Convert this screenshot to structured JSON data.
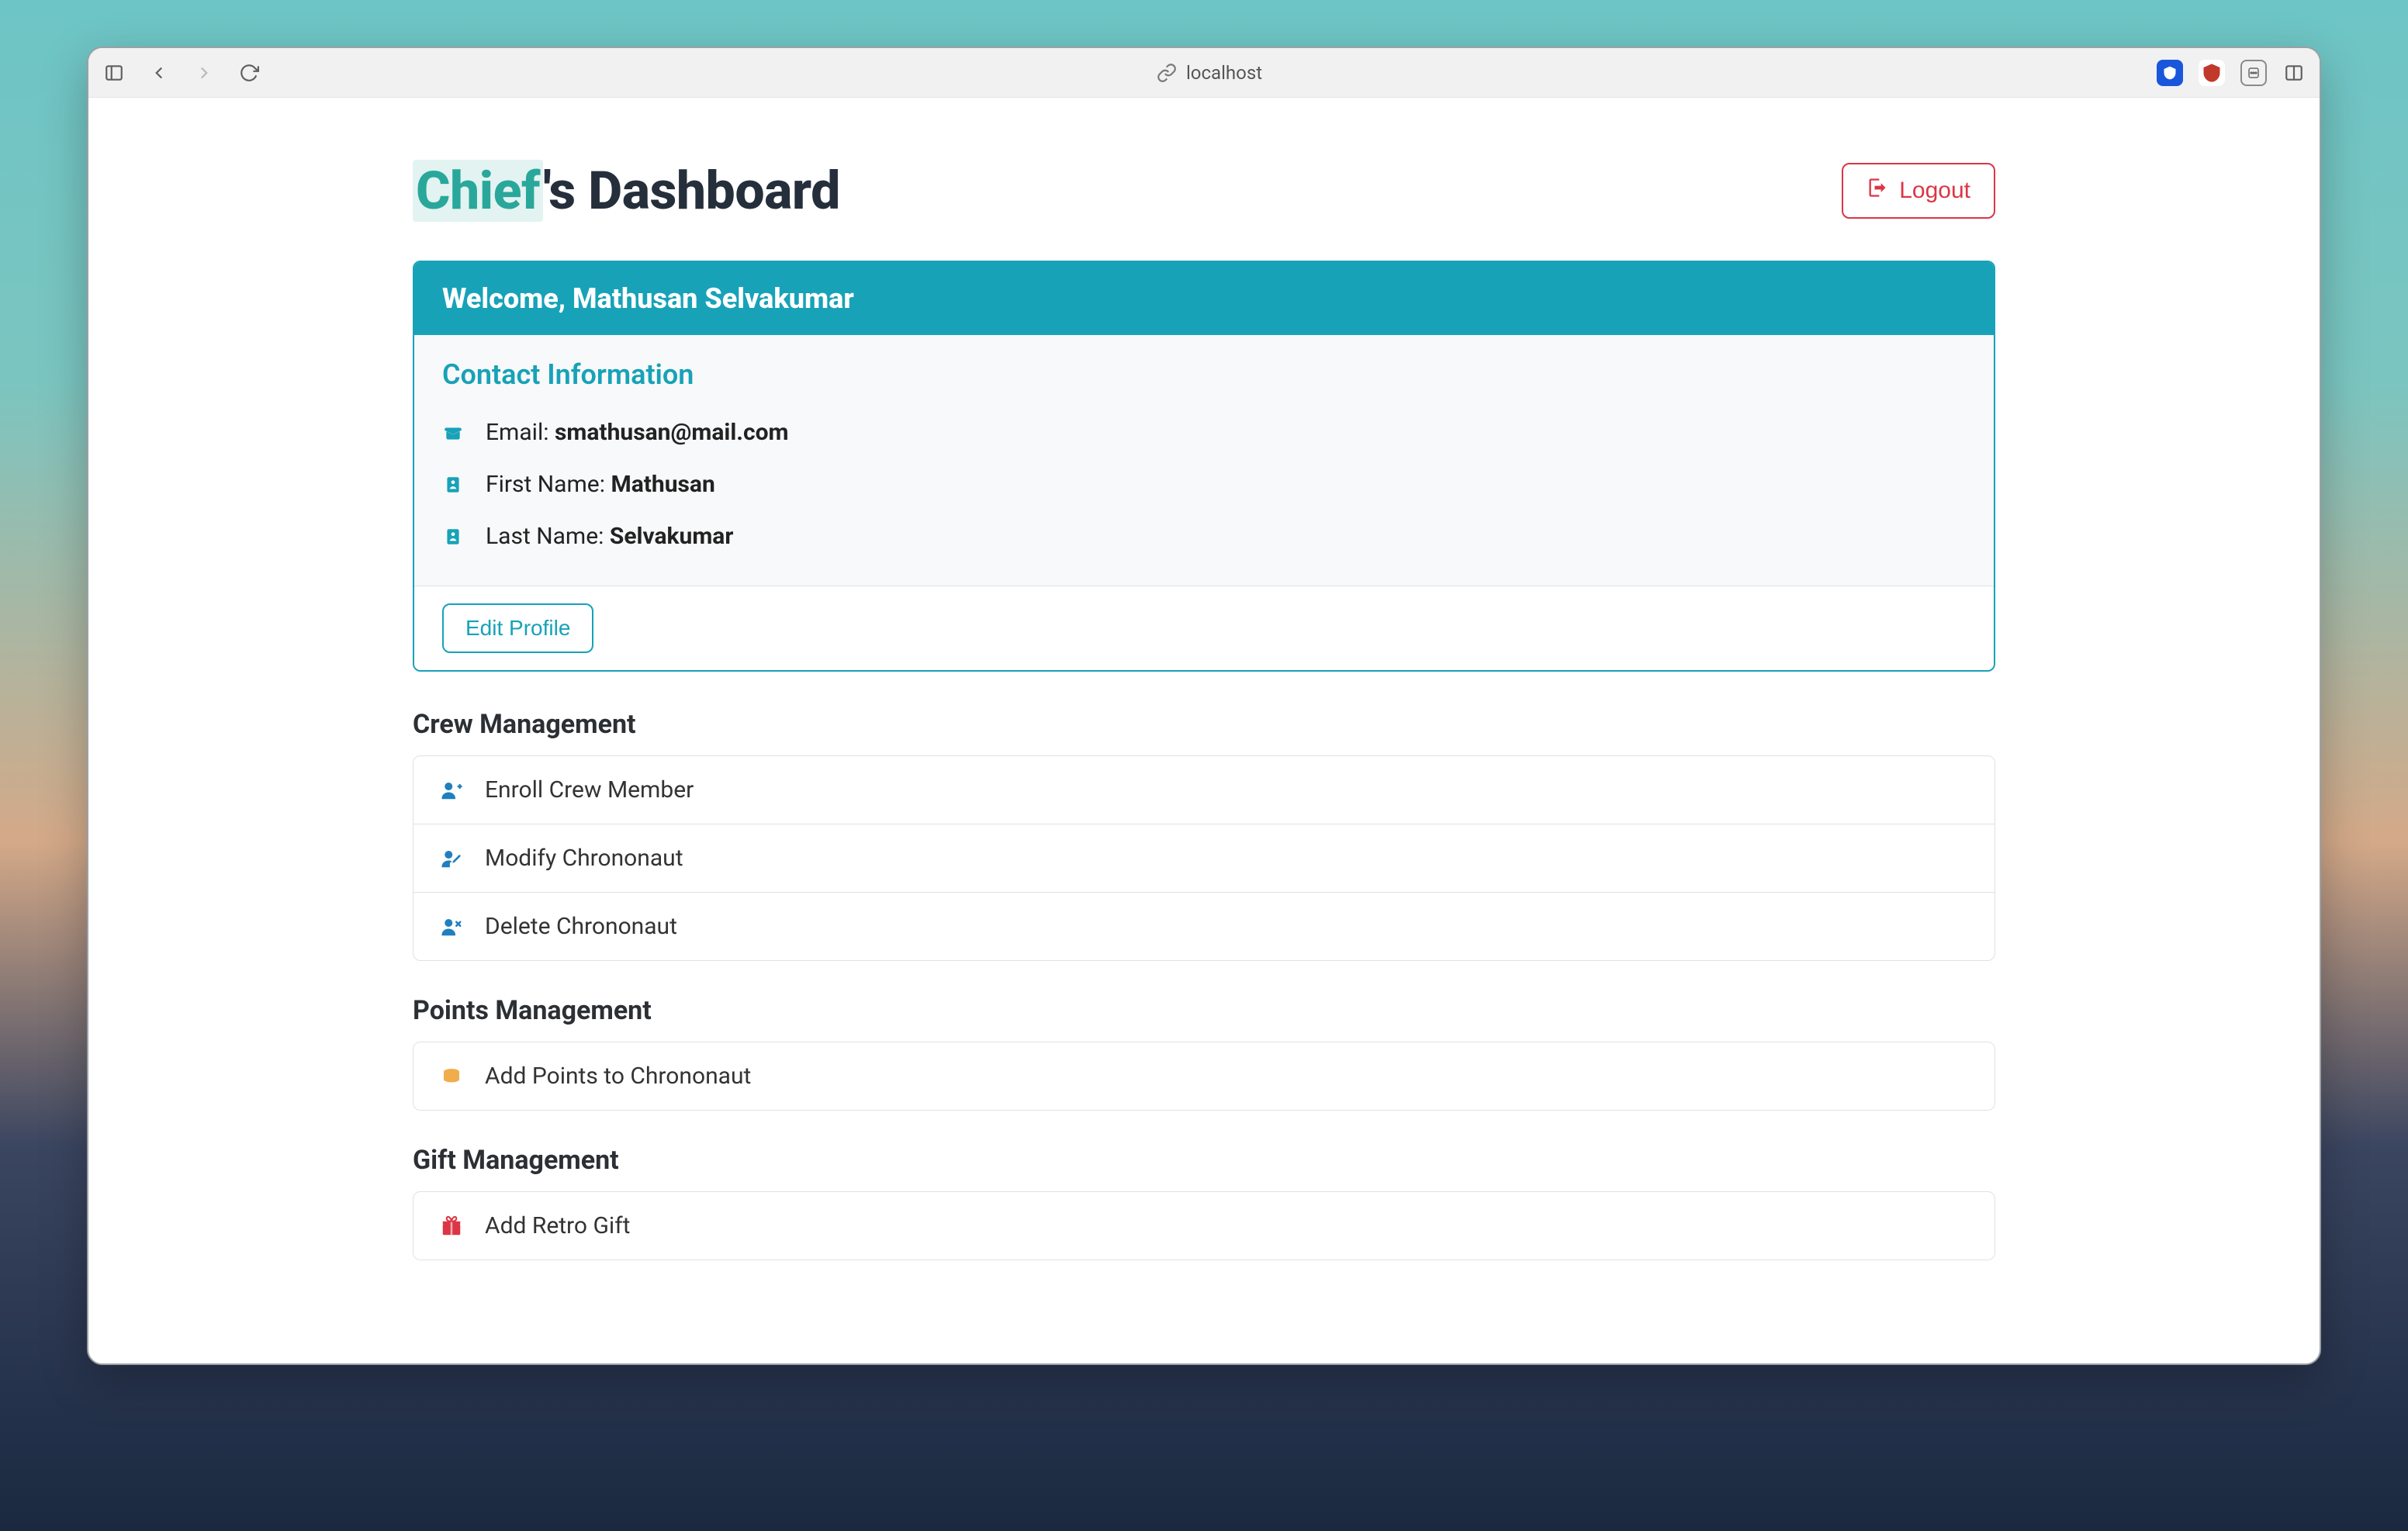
{
  "browser": {
    "address": "localhost"
  },
  "header": {
    "role": "Chief",
    "title_suffix": "'s Dashboard",
    "logout_label": "Logout"
  },
  "welcome": {
    "prefix": "Welcome, ",
    "full_name": "Mathusan Selvakumar"
  },
  "contact": {
    "heading": "Contact Information",
    "email_label": "Email: ",
    "email_value": "smathusan@mail.com",
    "first_name_label": "First Name: ",
    "first_name_value": "Mathusan",
    "last_name_label": "Last Name: ",
    "last_name_value": "Selvakumar",
    "edit_label": "Edit Profile"
  },
  "sections": {
    "crew": {
      "heading": "Crew Management",
      "items": [
        {
          "label": "Enroll Crew Member"
        },
        {
          "label": "Modify Chrononaut"
        },
        {
          "label": "Delete Chrononaut"
        }
      ]
    },
    "points": {
      "heading": "Points Management",
      "items": [
        {
          "label": "Add Points to Chrononaut"
        }
      ]
    },
    "gift": {
      "heading": "Gift Management",
      "items": [
        {
          "label": "Add Retro Gift"
        }
      ]
    }
  }
}
